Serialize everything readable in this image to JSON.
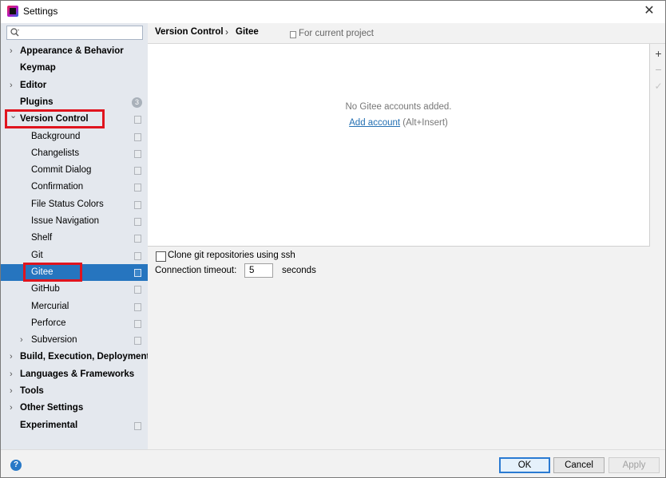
{
  "window": {
    "title": "Settings"
  },
  "search": {
    "value": "",
    "placeholder": ""
  },
  "sidebar": {
    "items": [
      {
        "label": "Appearance & Behavior",
        "level": 0,
        "expandable": true
      },
      {
        "label": "Keymap",
        "level": 0
      },
      {
        "label": "Editor",
        "level": 0,
        "expandable": true
      },
      {
        "label": "Plugins",
        "level": 0,
        "badge": "3"
      },
      {
        "label": "Version Control",
        "level": 0,
        "expanded": true,
        "highlighted": true
      },
      {
        "label": "Background",
        "level": 1
      },
      {
        "label": "Changelists",
        "level": 1
      },
      {
        "label": "Commit Dialog",
        "level": 1
      },
      {
        "label": "Confirmation",
        "level": 1
      },
      {
        "label": "File Status Colors",
        "level": 1
      },
      {
        "label": "Issue Navigation",
        "level": 1
      },
      {
        "label": "Shelf",
        "level": 1
      },
      {
        "label": "Git",
        "level": 1
      },
      {
        "label": "Gitee",
        "level": 1,
        "selected": true,
        "highlighted": true
      },
      {
        "label": "GitHub",
        "level": 1
      },
      {
        "label": "Mercurial",
        "level": 1
      },
      {
        "label": "Perforce",
        "level": 1
      },
      {
        "label": "Subversion",
        "level": 1,
        "expandable": true
      },
      {
        "label": "Build, Execution, Deployment",
        "level": 0,
        "expandable": true
      },
      {
        "label": "Languages & Frameworks",
        "level": 0,
        "expandable": true
      },
      {
        "label": "Tools",
        "level": 0,
        "expandable": true
      },
      {
        "label": "Other Settings",
        "level": 0,
        "expandable": true
      },
      {
        "label": "Experimental",
        "level": 0
      }
    ]
  },
  "header": {
    "breadcrumb": [
      "Version Control",
      "Gitee"
    ],
    "separator": "›",
    "scope_label": "For current project"
  },
  "accounts": {
    "empty_text": "No Gitee accounts added.",
    "add_link": "Add account",
    "add_shortcut": "(Alt+Insert)",
    "toolbar": {
      "add": "+",
      "remove": "−",
      "check": "✓"
    }
  },
  "options": {
    "clone_ssh_label": "Clone git repositories using ssh",
    "clone_ssh_checked": false,
    "timeout_label": "Connection timeout:",
    "timeout_value": "5",
    "timeout_unit": "seconds"
  },
  "footer": {
    "help": "?",
    "ok": "OK",
    "cancel": "Cancel",
    "apply": "Apply"
  },
  "colors": {
    "selection": "#2675bf",
    "highlight_box": "#e0141e",
    "link": "#2470b3"
  }
}
